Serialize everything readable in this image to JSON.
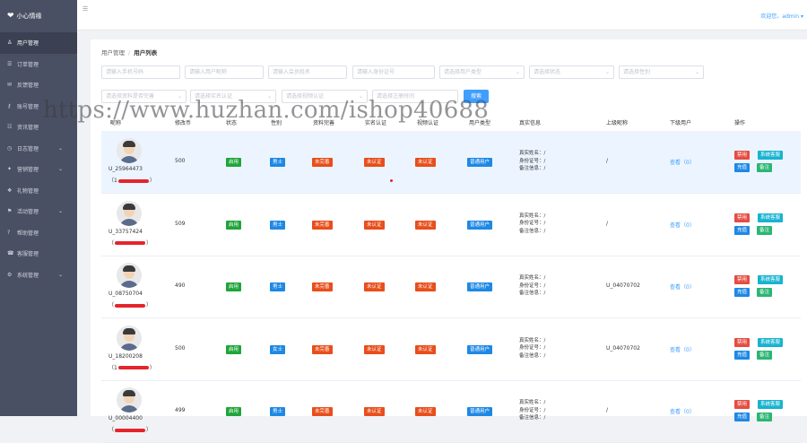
{
  "app": {
    "logo": "小心情缘"
  },
  "nav": [
    {
      "label": "用户管理",
      "icon": "user-icon",
      "active": true,
      "chev": false
    },
    {
      "label": "订单管理",
      "icon": "order-icon",
      "chev": false
    },
    {
      "label": "反馈管理",
      "icon": "feedback-icon",
      "chev": false
    },
    {
      "label": "账号管理",
      "icon": "account-icon",
      "chev": false
    },
    {
      "label": "资讯管理",
      "icon": "news-icon",
      "chev": false
    },
    {
      "label": "日志管理",
      "icon": "log-icon",
      "chev": true
    },
    {
      "label": "营销管理",
      "icon": "marketing-icon",
      "chev": true
    },
    {
      "label": "礼物管理",
      "icon": "gift-icon",
      "chev": false
    },
    {
      "label": "活动管理",
      "icon": "activity-icon",
      "chev": true
    },
    {
      "label": "帮助管理",
      "icon": "help-icon",
      "chev": false
    },
    {
      "label": "客服管理",
      "icon": "service-icon",
      "chev": false
    },
    {
      "label": "系统管理",
      "icon": "system-icon",
      "chev": true
    }
  ],
  "topbar": {
    "welcome": "欢迎您，admin ▾"
  },
  "breadcrumb": {
    "parent": "用户管理",
    "current": "用户列表"
  },
  "filters": {
    "row1": [
      "请输入手机号码",
      "请输入用户昵称",
      "请输入会员姓名",
      "请输入身份证号",
      "请选择用户类型",
      "请选择状态",
      "请选择性别"
    ],
    "row2": [
      "请选择资料是否完善",
      "请选择实名认证",
      "请选择视频认证",
      "请选择注册时间"
    ],
    "search": "搜索"
  },
  "columns": [
    "昵称",
    "修改币",
    "状态",
    "性别",
    "资料完善",
    "实名认证",
    "视频认证",
    "用户类型",
    "真实信息",
    "上级昵称",
    "下级用户",
    "操作"
  ],
  "info_labels": {
    "name": "真实姓名：/",
    "id": "身份证号：/",
    "note": "备注信息：/"
  },
  "actions": {
    "disable": "禁用",
    "edit": "系统客服",
    "recharge": "充值",
    "remark": "备注"
  },
  "rows": [
    {
      "uid": "U_25964473",
      "coins": "500",
      "status": "启用",
      "gender": "男士",
      "profile": "未完善",
      "realname": "未认证",
      "video": "未认证",
      "type": "普通用户",
      "parent": "/",
      "sub": "查看（0）",
      "phone_l": "（1",
      "phone_r": "）"
    },
    {
      "uid": "U_33757424",
      "coins": "509",
      "status": "启用",
      "gender": "男士",
      "profile": "未完善",
      "realname": "未认证",
      "video": "未认证",
      "type": "普通用户",
      "parent": "/",
      "sub": "查看（0）",
      "phone_l": "（",
      "phone_r": "）"
    },
    {
      "uid": "U_08750704",
      "coins": "490",
      "status": "启用",
      "gender": "男士",
      "profile": "未完善",
      "realname": "未认证",
      "video": "未认证",
      "type": "普通用户",
      "parent": "U_04070702",
      "sub": "查看（0）",
      "phone_l": "（",
      "phone_r": "）"
    },
    {
      "uid": "U_18200208",
      "coins": "500",
      "status": "启用",
      "gender": "女士",
      "profile": "未完善",
      "realname": "未认证",
      "video": "未认证",
      "type": "普通用户",
      "parent": "U_04070702",
      "sub": "查看（0）",
      "phone_l": "（1",
      "phone_r": "）"
    },
    {
      "uid": "U_00004400",
      "coins": "499",
      "status": "启用",
      "gender": "男士",
      "profile": "未完善",
      "realname": "未认证",
      "video": "未认证",
      "type": "普通用户",
      "parent": "/",
      "sub": "查看（0）",
      "phone_l": "（",
      "phone_r": "）"
    }
  ],
  "watermark": "https://www.huzhan.com/ishop40688"
}
